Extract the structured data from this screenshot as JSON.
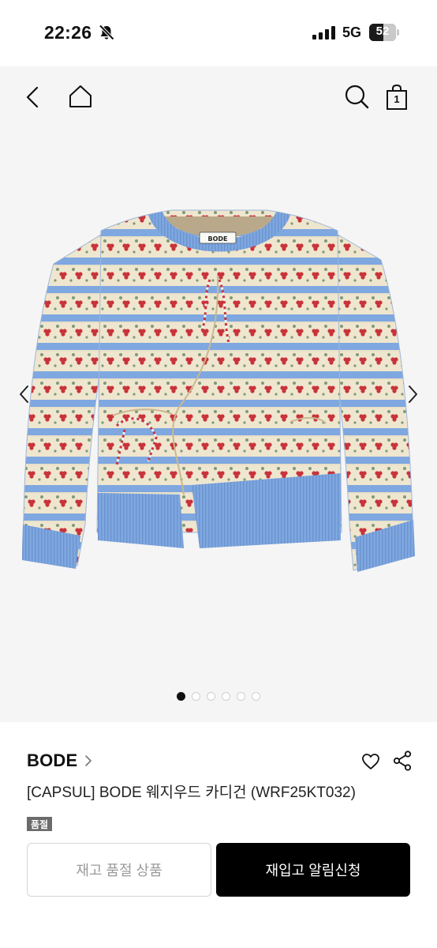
{
  "status_bar": {
    "time": "22:26",
    "network": "5G",
    "battery_level": "52",
    "battery_fraction": 0.52,
    "icons": [
      "bell-off-icon",
      "signal-bars-icon",
      "battery-icon"
    ]
  },
  "gallery": {
    "cart_count": "1",
    "image_count": 6,
    "active_index": 0,
    "image_brand_tag": "BODE",
    "colors": {
      "background": "#f5f5f5",
      "sweater_blue": "#7fa7e0",
      "sweater_cream": "#efe6cf",
      "motif_red": "#c8333a",
      "motif_green": "#7f9a78"
    }
  },
  "product": {
    "brand": "BODE",
    "name": "[CAPSUL] BODE 웨지우드 카디건 (WRF25KT032)",
    "badge": "품절"
  },
  "actions": {
    "sold_out_label": "재고 품절 상품",
    "restock_label": "재입고 알림신청"
  }
}
